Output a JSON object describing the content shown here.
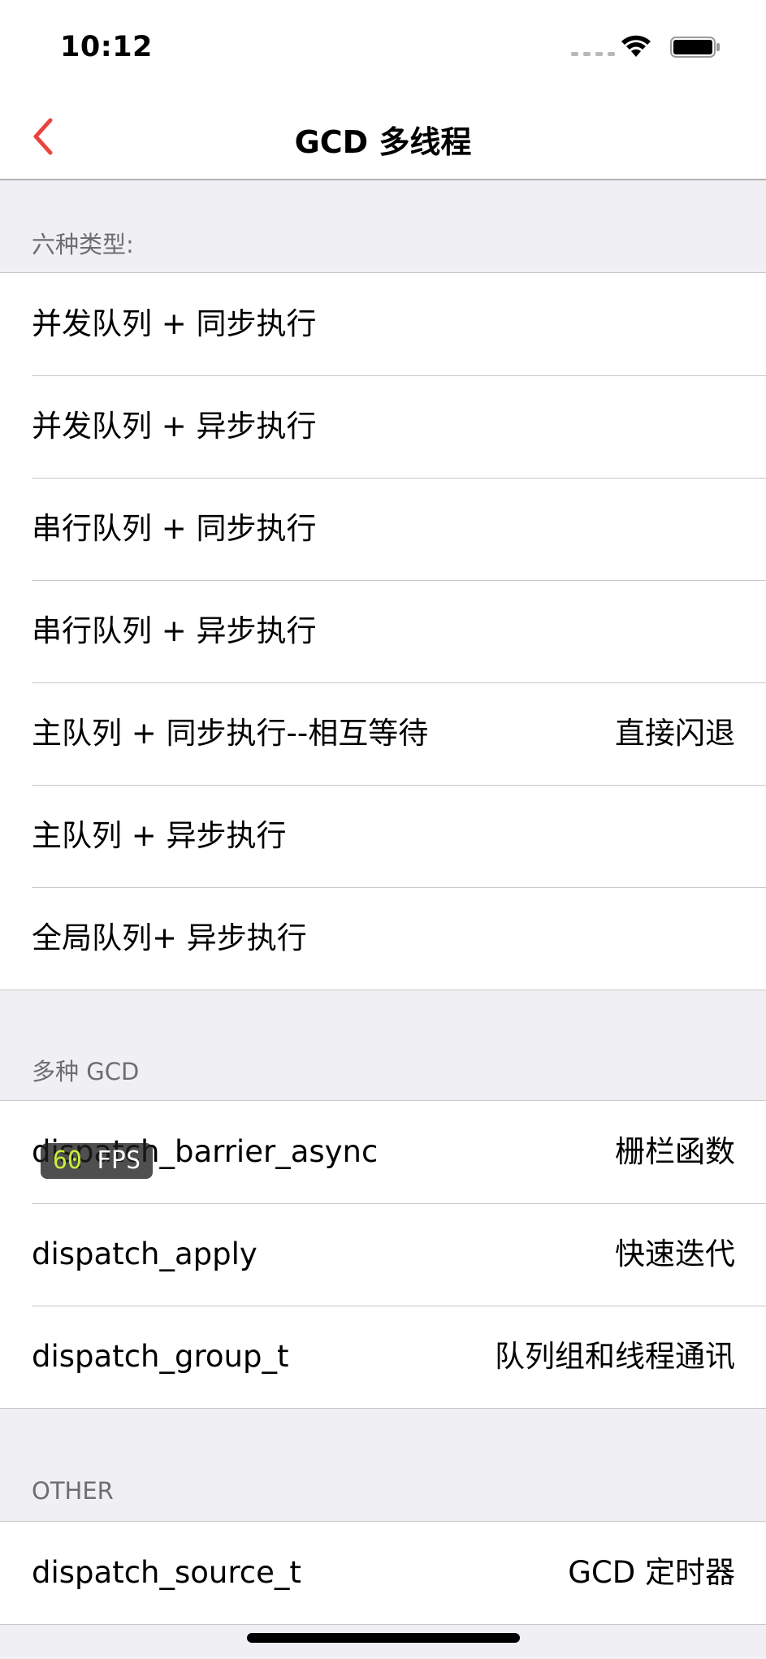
{
  "status_bar": {
    "time": "10:12",
    "icons": [
      "signal-icon",
      "wifi-icon",
      "battery-icon"
    ]
  },
  "nav": {
    "title": "GCD 多线程",
    "back_icon": "chevron-left-icon",
    "accent_color": "#e8453c"
  },
  "sections": [
    {
      "header": "六种类型:",
      "rows": [
        {
          "title": "并发队列 + 同步执行",
          "detail": ""
        },
        {
          "title": "并发队列 + 异步执行",
          "detail": ""
        },
        {
          "title": "串行队列 + 同步执行",
          "detail": ""
        },
        {
          "title": "串行队列 + 异步执行",
          "detail": ""
        },
        {
          "title": "主队列 + 同步执行--相互等待",
          "detail": "直接闪退"
        },
        {
          "title": "主队列 + 异步执行",
          "detail": ""
        },
        {
          "title": "全局队列+ 异步执行",
          "detail": ""
        }
      ]
    },
    {
      "header": "多种 GCD",
      "rows": [
        {
          "title": "dispatch_barrier_async",
          "detail": "栅栏函数"
        },
        {
          "title": "dispatch_apply",
          "detail": "快速迭代"
        },
        {
          "title": "dispatch_group_t",
          "detail": "队列组和线程通讯"
        }
      ]
    },
    {
      "header": "OTHER",
      "rows": [
        {
          "title": "dispatch_source_t",
          "detail": "GCD 定时器"
        }
      ]
    }
  ],
  "fps_overlay": {
    "value": "60",
    "unit": "FPS",
    "value_color": "#c6ef3a"
  }
}
